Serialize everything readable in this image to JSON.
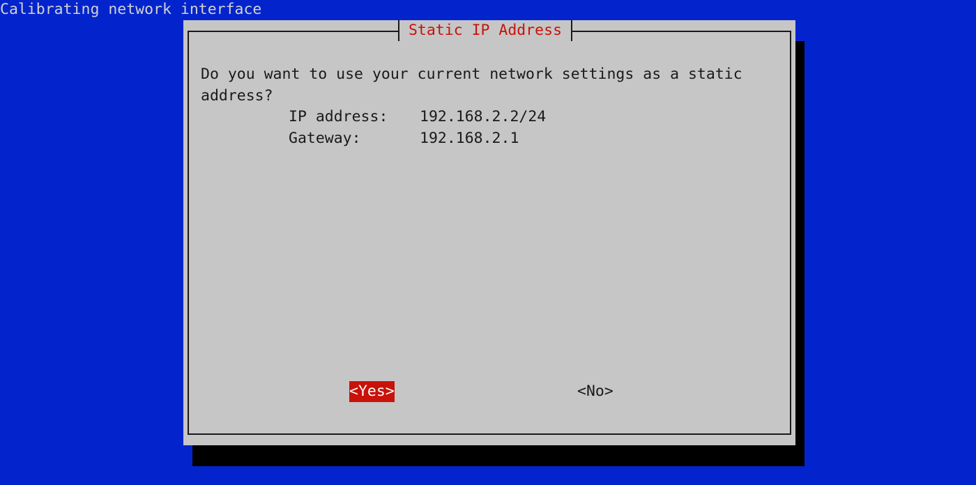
{
  "screen": {
    "backtitle": "Calibrating network interface"
  },
  "dialog": {
    "title": "Static IP Address",
    "message": "Do you want to use your current network settings as a static\naddress?",
    "info": [
      {
        "label": "IP address:",
        "value": "192.168.2.2/24"
      },
      {
        "label": "Gateway:",
        "value": "192.168.2.1"
      }
    ],
    "buttons": {
      "yes": "<Yes>",
      "no": "<No>"
    }
  },
  "colors": {
    "background": "#0324cc",
    "dialog_bg": "#c6c6c6",
    "title_text": "#c8120a",
    "selected_button_bg": "#c8120a",
    "shadow": "#000000"
  }
}
